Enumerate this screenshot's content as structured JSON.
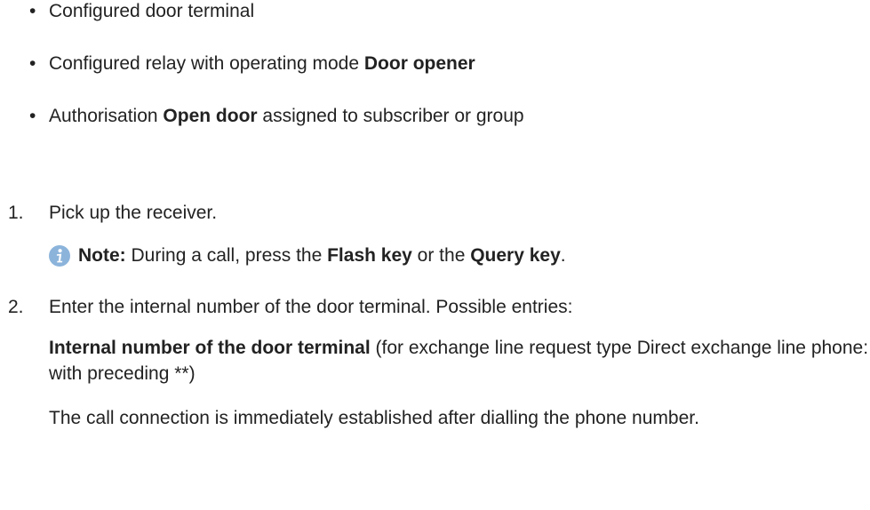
{
  "prerequisites": [
    {
      "text": "Configured door terminal",
      "bold": ""
    },
    {
      "text": "Configured relay with operating mode ",
      "bold": "Door opener"
    },
    {
      "text_pre": "Authorisation ",
      "bold": "Open door",
      "text_post": " assigned to subscriber or group"
    }
  ],
  "steps": {
    "step1": {
      "number": "1.",
      "text": "Pick up the receiver.",
      "note": {
        "label": "Note:",
        "text_a": " During a call, press the ",
        "bold_a": "Flash key",
        "text_b": " or the ",
        "bold_b": "Query key",
        "text_c": ".",
        "icon": "info-icon",
        "icon_color": "#8cb4db"
      }
    },
    "step2": {
      "number": "2.",
      "text": "Enter the internal number of the door terminal. Possible entries:",
      "entry_bold": "Internal number of the door terminal",
      "entry_text": " (for exchange line request type Direct exchange line phone: with preceding **)",
      "result": "The call connection is immediately established after dialling the phone number."
    }
  },
  "bullet_glyph": "•"
}
